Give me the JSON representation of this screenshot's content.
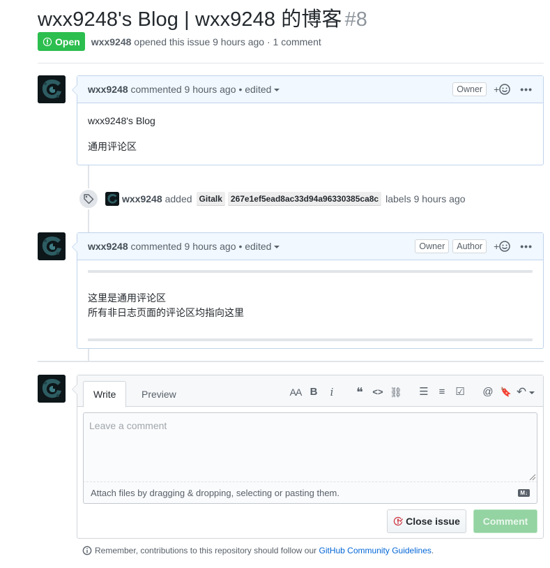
{
  "issue": {
    "title": "wxx9248's Blog | wxx9248 的博客",
    "number": "#8",
    "state": "Open",
    "author": "wxx9248",
    "meta_rest": "opened this issue 9 hours ago · 1 comment"
  },
  "comments": [
    {
      "author": "wxx9248",
      "action": "commented 9 hours ago",
      "edited": "• edited",
      "labels": [
        "Owner"
      ],
      "body": [
        "wxx9248's Blog",
        "通用评论区"
      ]
    },
    {
      "author": "wxx9248",
      "action": "commented 9 hours ago",
      "edited": "• edited",
      "labels": [
        "Owner",
        "Author"
      ],
      "body": [
        "这里是通用评论区",
        "所有非日志页面的评论区均指向这里"
      ]
    }
  ],
  "event": {
    "actor": "wxx9248",
    "verb": "added",
    "labels": [
      "Gitalk",
      "267e1ef5ead8ac33d94a96330385ca8c"
    ],
    "after": "labels 9 hours ago"
  },
  "reaction_symbol": "+",
  "more_symbol": "•••",
  "editor": {
    "tabs": [
      "Write",
      "Preview"
    ],
    "toolbar": {
      "heading": "AA",
      "bold": "B",
      "italic": "i",
      "quote": "❝",
      "code": "<>",
      "link": "⛓",
      "ul": "☰",
      "ol": "≡",
      "task": "☑",
      "mention": "@",
      "saved": "🔖",
      "reply": "↶"
    },
    "placeholder": "Leave a comment",
    "attach_text": "Attach files by dragging & dropping, selecting or pasting them.",
    "md_badge": "M↓",
    "close_label": "Close issue",
    "comment_label": "Comment"
  },
  "footer": {
    "text": "Remember, contributions to this repository should follow our",
    "link": "GitHub Community Guidelines",
    "period": "."
  },
  "colors": {
    "open_green": "#2cbe4e",
    "comment_header": "#f1f8ff",
    "link_blue": "#0366d6",
    "comment_button": "#94d3a2"
  }
}
